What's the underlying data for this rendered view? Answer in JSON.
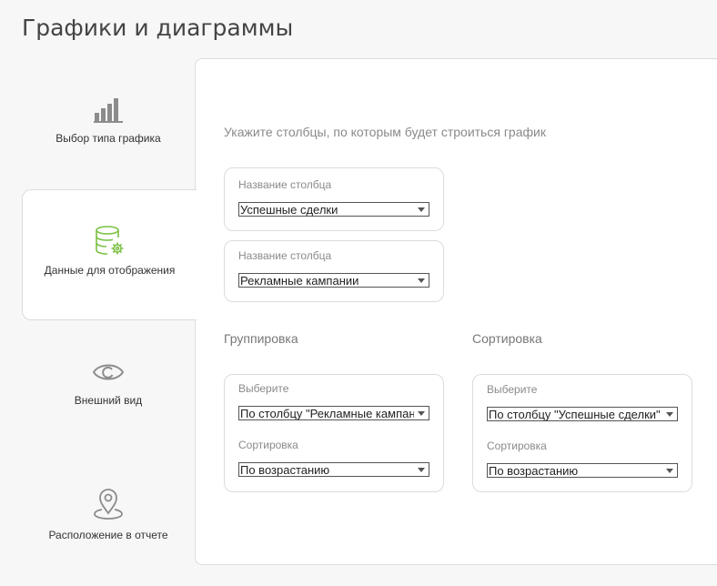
{
  "page": {
    "title": "Графики и диаграммы"
  },
  "steps": [
    {
      "label": "Выбор типа графика",
      "icon": "bar-chart-icon",
      "active": false
    },
    {
      "label": "Данные для отображения",
      "icon": "database-settings-icon",
      "active": true
    },
    {
      "label": "Внешний вид",
      "icon": "eye-icon",
      "active": false
    },
    {
      "label": "Расположение в отчете",
      "icon": "location-pin-icon",
      "active": false
    }
  ],
  "colors": {
    "accent": "#7ac043",
    "icon_gray": "#8c8c8c",
    "border": "#dcdcdc"
  },
  "main": {
    "instruction": "Укажите столбцы, по которым будет строиться график",
    "columns": [
      {
        "label": "Название столбца",
        "value": "Успешные сделки"
      },
      {
        "label": "Название столбца",
        "value": "Рекламные кампании"
      }
    ],
    "grouping": {
      "title": "Группировка",
      "select_label": "Выберите",
      "select_value": "По столбцу \"Рекламные кампании\"",
      "sort_label": "Сортировка",
      "sort_value": "По возрастанию"
    },
    "sorting": {
      "title": "Сортировка",
      "select_label": "Выберите",
      "select_value": "По столбцу \"Успешные сделки\"",
      "sort_label": "Сортировка",
      "sort_value": "По возрастанию"
    }
  }
}
